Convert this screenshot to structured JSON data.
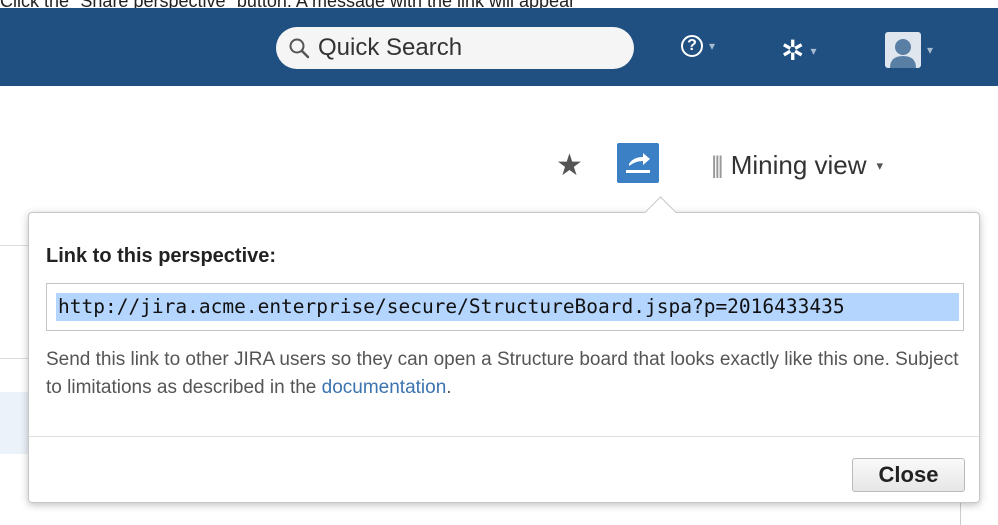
{
  "caption": "Click the \"Share perspective\" button. A message with the link will appear",
  "header": {
    "search_placeholder": "Quick Search",
    "caret": "▾",
    "help_glyph": "?",
    "gear_glyph": "✲",
    "brand_color": "#205081"
  },
  "toolbar": {
    "star_glyph": "★",
    "view_label": "Mining view",
    "view_caret": "▾",
    "share_color": "#3b7fc4"
  },
  "popup": {
    "title": "Link to this perspective:",
    "link": "http://jira.acme.enterprise/secure/StructureBoard.jspa?p=2016433435",
    "description_prefix": "Send this link to other JIRA users so they can open a Structure board that looks exactly like this one. Subject to limitations as described in the ",
    "description_link": "documentation",
    "description_suffix": ".",
    "close_label": "Close"
  }
}
